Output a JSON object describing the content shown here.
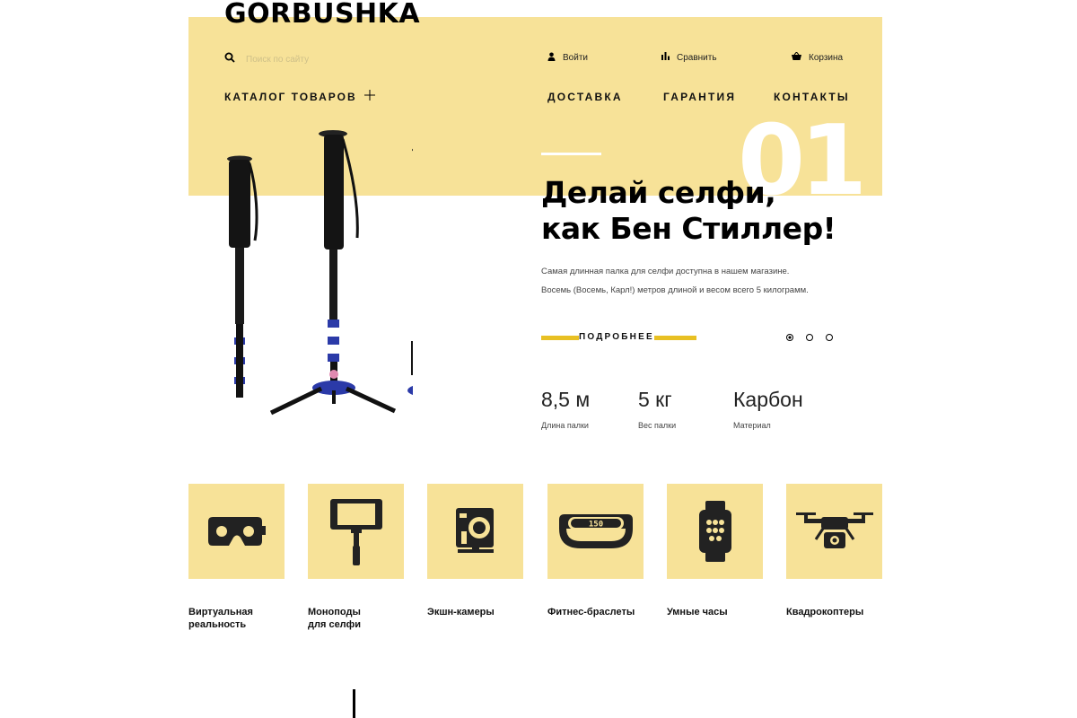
{
  "header": {
    "logo": "GORBUSHKA",
    "search_placeholder": "Поиск по сайту",
    "login": "Войти",
    "compare": "Сравнить",
    "cart": "Корзина",
    "catalog": "КАТАЛОГ ТОВАРОВ",
    "nav": [
      "ДОСТАВКА",
      "ГАРАНТИЯ",
      "КОНТАКТЫ"
    ]
  },
  "hero": {
    "slide_number": "01",
    "title_line1": "Делай селфи,",
    "title_line2": "как Бен Стиллер!",
    "description_line1": "Самая длинная палка для селфи доступна в нашем магазине.",
    "description_line2": "Восемь (Восемь, Карл!) метров длиной и весом всего 5 килограмм.",
    "more_button": "ПОДРОБНЕЕ",
    "slides_total": 3,
    "active_slide": 1,
    "specs": [
      {
        "value": "8,5 м",
        "label": "Длина палки"
      },
      {
        "value": "5 кг",
        "label": "Вес палки"
      },
      {
        "value": "Карбон",
        "label": "Материал"
      }
    ]
  },
  "categories": [
    {
      "label_line1": "Виртуальная",
      "label_line2": "реальность",
      "icon": "vr-headset-icon"
    },
    {
      "label_line1": "Моноподы",
      "label_line2": "для селфи",
      "icon": "selfie-stick-icon"
    },
    {
      "label_line1": "Экшн-камеры",
      "label_line2": "",
      "icon": "action-camera-icon"
    },
    {
      "label_line1": "Фитнес-браслеты",
      "label_line2": "",
      "icon": "fitness-band-icon"
    },
    {
      "label_line1": "Умные часы",
      "label_line2": "",
      "icon": "smartwatch-icon"
    },
    {
      "label_line1": "Квадрокоптеры",
      "label_line2": "",
      "icon": "drone-icon"
    }
  ],
  "fitness_band_display": "150",
  "colors": {
    "accent_yellow": "#f7e298",
    "button_bar": "#e8c023",
    "text": "#111111"
  }
}
